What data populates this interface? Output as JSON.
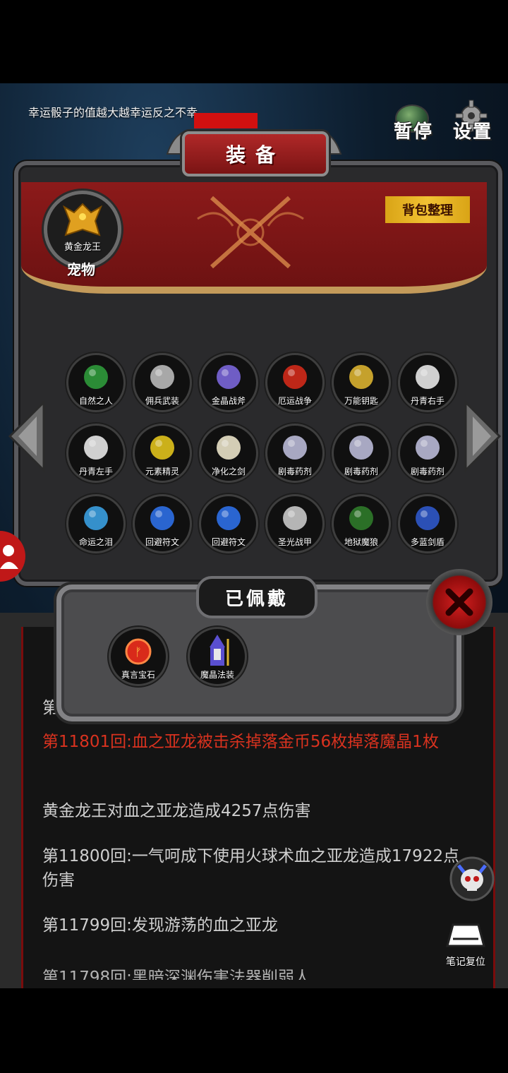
{
  "hint_text": "幸运骰子的值越大越幸运反之不幸",
  "top_buttons": {
    "pause": "暂停",
    "settings": "设置"
  },
  "panel": {
    "title": "装备",
    "bag_sort_button": "背包整理",
    "pet": {
      "name": "黄金龙王",
      "label": "宠物"
    }
  },
  "items": [
    {
      "label": "自然之人",
      "icon": "green-hydra-icon",
      "color": "#2f9a3b"
    },
    {
      "label": "佣兵武装",
      "icon": "knight-armor-icon",
      "color": "#b9b9b9"
    },
    {
      "label": "金晶战斧",
      "icon": "battle-axe-icon",
      "color": "#7a66d9"
    },
    {
      "label": "厄运战争",
      "icon": "red-warrior-icon",
      "color": "#d12a1a"
    },
    {
      "label": "万能钥匙",
      "icon": "golden-key-icon",
      "color": "#d9b130"
    },
    {
      "label": "丹青右手",
      "icon": "white-glove-icon",
      "color": "#e6e6e6"
    },
    {
      "label": "丹青左手",
      "icon": "white-glove-icon",
      "color": "#e6e6e6"
    },
    {
      "label": "元素精灵",
      "icon": "yellow-sprite-icon",
      "color": "#e0c21c"
    },
    {
      "label": "净化之剑",
      "icon": "sword-icon",
      "color": "#e9e2c8"
    },
    {
      "label": "剧毒药剂",
      "icon": "potion-icon",
      "color": "#b9b9d6"
    },
    {
      "label": "剧毒药剂",
      "icon": "potion-icon",
      "color": "#b9b9d6"
    },
    {
      "label": "剧毒药剂",
      "icon": "potion-icon",
      "color": "#b9b9d6"
    },
    {
      "label": "命运之泪",
      "icon": "necklace-icon",
      "color": "#3a9fe0"
    },
    {
      "label": "回避符文",
      "icon": "blue-orb-icon",
      "color": "#2e6fe6"
    },
    {
      "label": "回避符文",
      "icon": "blue-orb-icon",
      "color": "#2e6fe6"
    },
    {
      "label": "圣光战甲",
      "icon": "plate-armor-icon",
      "color": "#c8c8c8"
    },
    {
      "label": "地狱魔狼",
      "icon": "hell-wolf-icon",
      "color": "#2f7a2a"
    },
    {
      "label": "多蓝剑盾",
      "icon": "shield-icon",
      "color": "#2f58c9"
    }
  ],
  "worn": {
    "title": "已佩戴",
    "items": [
      {
        "label": "真言宝石",
        "icon": "red-rune-gem-icon",
        "color": "#d92a1a"
      },
      {
        "label": "魔晶法装",
        "icon": "wizard-icon",
        "color": "#5a4fd0"
      }
    ]
  },
  "log": {
    "partial_top": "第",
    "lines": [
      {
        "text": "第11801回:血之亚龙被击杀掉落金币56枚掉落魔晶1枚",
        "highlight": true
      },
      {
        "text": "黄金龙王对血之亚龙造成4257点伤害",
        "highlight": false
      },
      {
        "text": "第11800回:一气呵成下使用火球术血之亚龙造成17922点伤害",
        "highlight": false
      },
      {
        "text": "第11799回:发现游荡的血之亚龙",
        "highlight": false
      }
    ],
    "partial_bottom": "第11798回:黑暗深渊伤害法器削弱人"
  },
  "note_reset": "笔记复位"
}
